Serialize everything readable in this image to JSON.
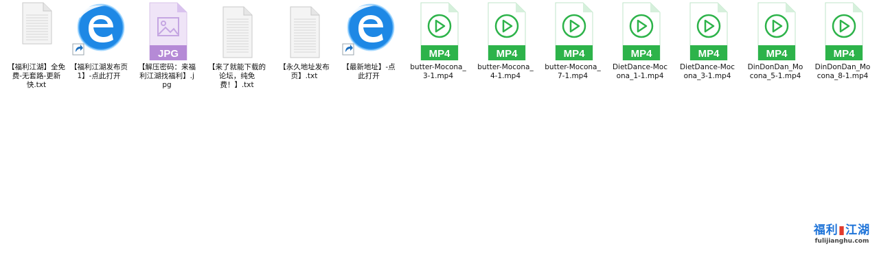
{
  "desktop": {
    "files": [
      {
        "name": "【福利江湖】全免费-无套路-更新快.txt",
        "type": "txt",
        "icon": "text-file-icon",
        "shortcut": false
      },
      {
        "name": "【福利江湖发布页1】-点此打开",
        "type": "url",
        "icon": "browser-shortcut-icon",
        "shortcut": true
      },
      {
        "name": "【解压密码：来福利江湖找福利】.jpg",
        "type": "jpg",
        "icon": "jpg-file-icon",
        "shortcut": false,
        "badge": "JPG"
      },
      {
        "name": "【来了就能下载的论坛，纯免费！】.txt",
        "type": "txt",
        "icon": "text-file-icon",
        "shortcut": false
      },
      {
        "name": "【永久地址发布页】.txt",
        "type": "txt",
        "icon": "text-file-icon",
        "shortcut": false
      },
      {
        "name": "【最新地址】-点此打开",
        "type": "url",
        "icon": "browser-shortcut-icon",
        "shortcut": true
      },
      {
        "name": "butter-Mocona_3-1.mp4",
        "type": "mp4",
        "icon": "mp4-file-icon",
        "shortcut": false,
        "badge": "MP4"
      },
      {
        "name": "butter-Mocona_4-1.mp4",
        "type": "mp4",
        "icon": "mp4-file-icon",
        "shortcut": false,
        "badge": "MP4"
      },
      {
        "name": "butter-Mocona_7-1.mp4",
        "type": "mp4",
        "icon": "mp4-file-icon",
        "shortcut": false,
        "badge": "MP4"
      },
      {
        "name": "DietDance-Mocona_1-1.mp4",
        "type": "mp4",
        "icon": "mp4-file-icon",
        "shortcut": false,
        "badge": "MP4"
      },
      {
        "name": "DietDance-Mocona_3-1.mp4",
        "type": "mp4",
        "icon": "mp4-file-icon",
        "shortcut": false,
        "badge": "MP4"
      },
      {
        "name": "DinDonDan_Mocona_5-1.mp4",
        "type": "mp4",
        "icon": "mp4-file-icon",
        "shortcut": false,
        "badge": "MP4"
      },
      {
        "name": "DinDonDan_Mocona_8-1.mp4",
        "type": "mp4",
        "icon": "mp4-file-icon",
        "shortcut": false,
        "badge": "MP4"
      }
    ]
  },
  "watermark": {
    "title_part1": "福利",
    "title_part2": "江湖",
    "url": "fulijianghu.com"
  },
  "colors": {
    "mp4_green": "#2db34a",
    "jpg_purple": "#b58ad6",
    "browser_blue": "#1e88e5"
  }
}
